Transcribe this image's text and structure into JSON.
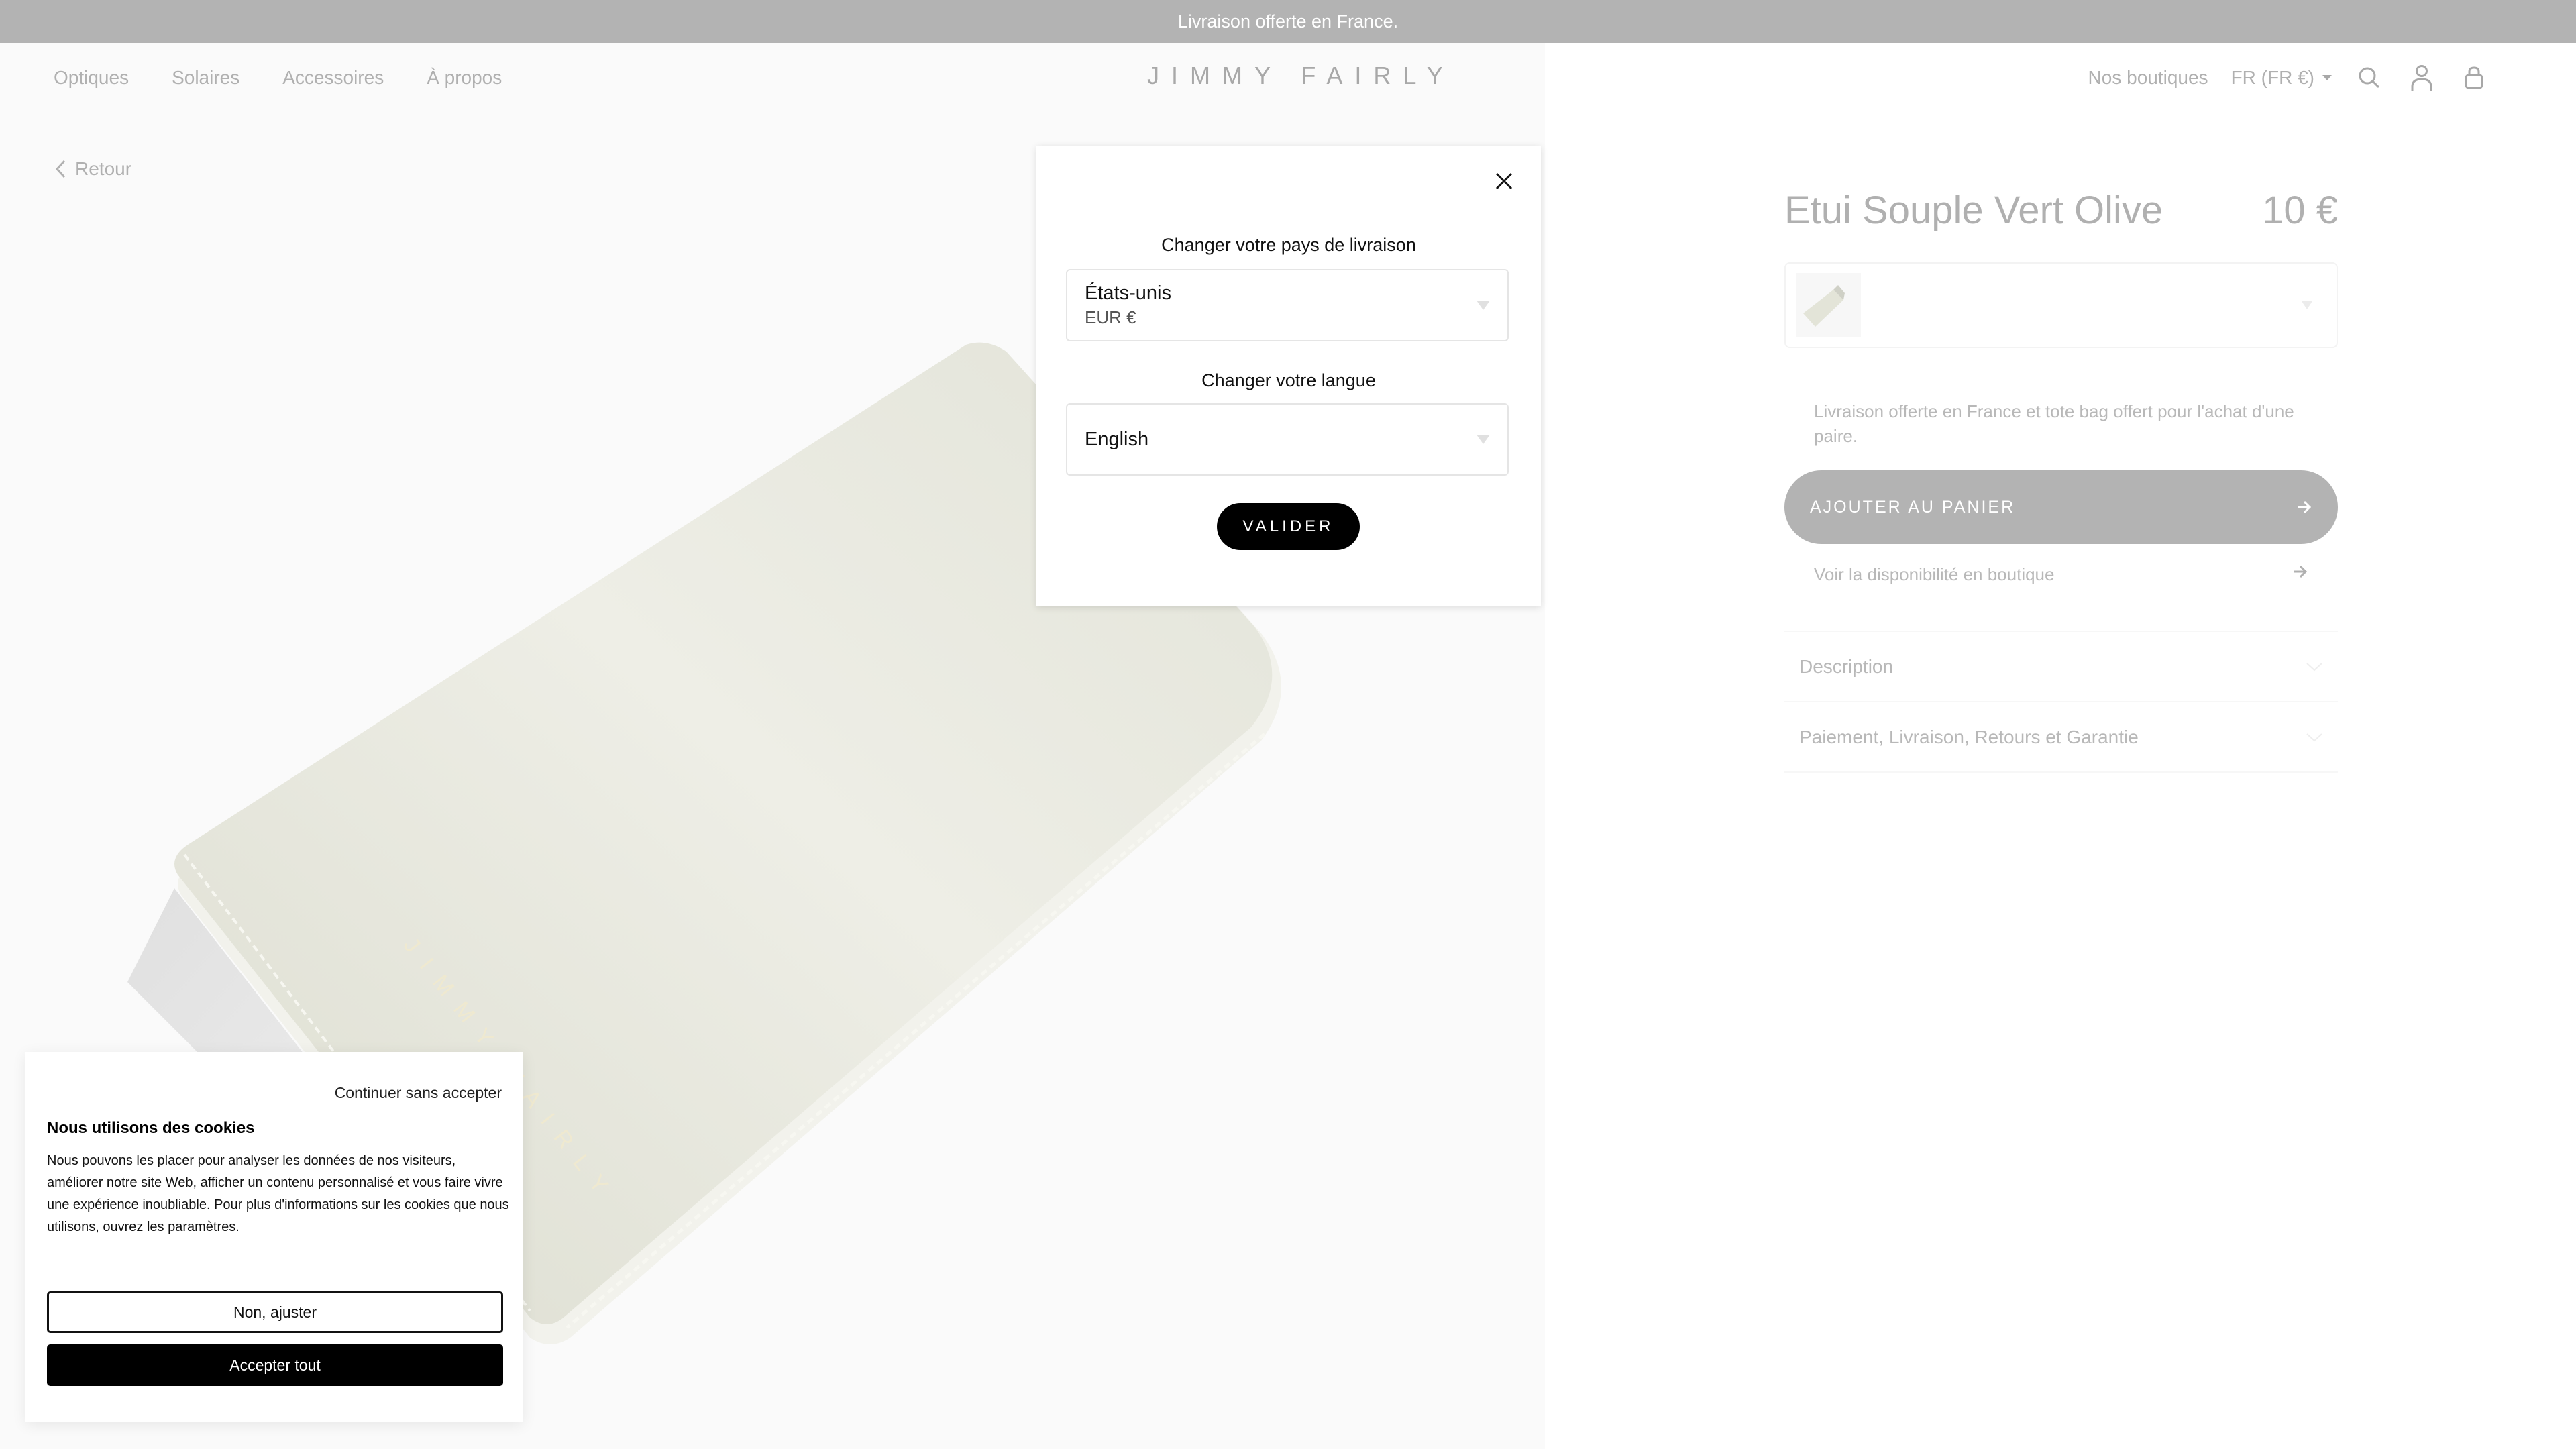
{
  "announcement": "Livraison offerte en France.",
  "header": {
    "nav": [
      "Optiques",
      "Solaires",
      "Accessoires",
      "À propos"
    ],
    "logo": "JIMMY FAIRLY",
    "stores": "Nos boutiques",
    "locale": "FR (FR €)",
    "icons": [
      "search-icon",
      "account-icon",
      "bag-icon"
    ]
  },
  "back": {
    "label": "Retour"
  },
  "product": {
    "title": "Etui Souple Vert Olive",
    "price": "10 €",
    "shipping_note": "Livraison offerte en France et tote bag offert pour l'achat d'une paire.",
    "add_to_cart": "AJOUTER AU PANIER",
    "store_availability": "Voir la disponibilité en boutique",
    "accordion": [
      "Description",
      "Paiement, Livraison, Retours et Garantie"
    ],
    "image_engraving": "JIMMY FAIRLY"
  },
  "modal": {
    "country_label": "Changer votre pays de livraison",
    "country_value": "États-unis",
    "currency_value": "EUR €",
    "language_label": "Changer votre langue",
    "language_value": "English",
    "submit": "VALIDER"
  },
  "cookie": {
    "continue": "Continuer sans accepter",
    "title": "Nous utilisons des cookies",
    "body": "Nous pouvons les placer pour analyser les données de nos visiteurs, améliorer notre site Web, afficher un contenu personnalisé et vous faire vivre une expérience inoubliable. Pour plus d'informations sur les cookies que nous utilisons, ouvrez les paramètres.",
    "adjust": "Non, ajuster",
    "accept": "Accepter tout"
  },
  "colors": {
    "overlay_gray": "#b3b3b3",
    "black": "#000000",
    "case_color": "#e4e5da"
  }
}
